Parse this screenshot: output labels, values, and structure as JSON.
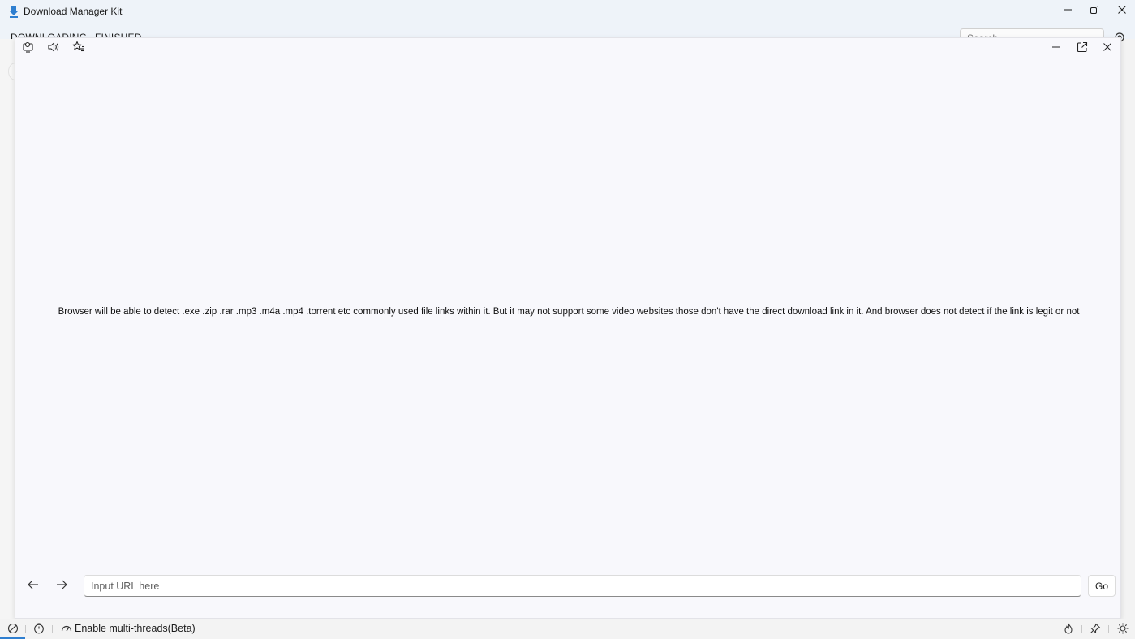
{
  "app": {
    "title": "Download Manager Kit",
    "accent_color": "#2f7fd0"
  },
  "window_controls": {
    "icons": [
      "minimize-icon",
      "restore-icon",
      "close-icon"
    ]
  },
  "tabs": [
    {
      "label": "DOWNLOADING"
    },
    {
      "label": "FINISHED"
    }
  ],
  "search": {
    "placeholder": "Search"
  },
  "browser": {
    "toolbar_icons": [
      "user-monitor-icon",
      "volume-icon",
      "favorites-icon"
    ],
    "window_icons": [
      "minimize-icon",
      "popout-icon",
      "close-icon"
    ],
    "info_text": "Browser will be able to detect .exe .zip .rar .mp3 .m4a .mp4 .torrent etc commonly used file links within it. But it may not support some video websites those don't have the direct download link in it. And browser does not detect if the link is legit or not",
    "url_placeholder": "Input URL here",
    "go_label": "Go"
  },
  "statusbar": {
    "multithread_label": "Enable multi-threads(Beta)",
    "icons": [
      "speed-limit-icon",
      "timer-icon",
      "speedometer-icon",
      "flame-icon",
      "pin-icon",
      "theme-icon"
    ]
  }
}
